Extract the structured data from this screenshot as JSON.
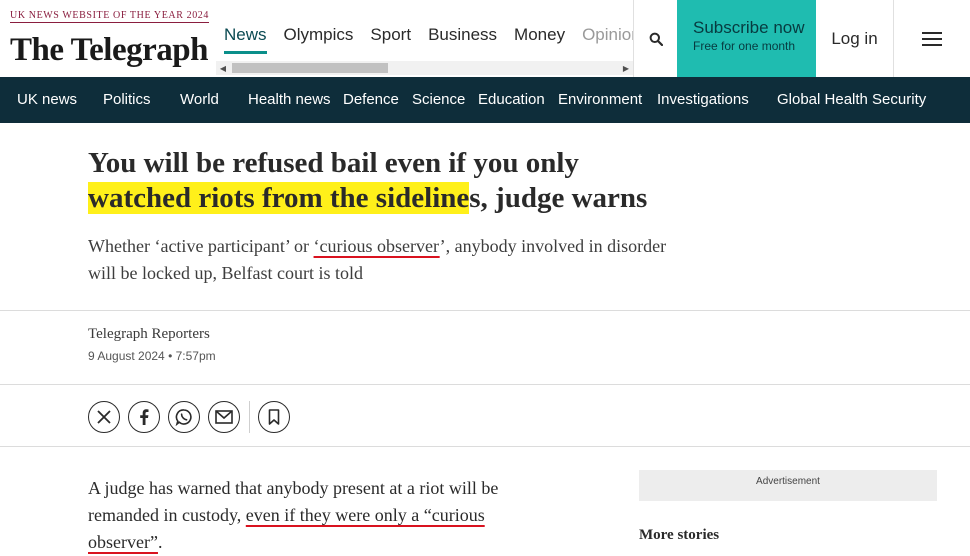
{
  "header": {
    "award": "UK NEWS WEBSITE OF THE YEAR 2024",
    "logo": "The Telegraph",
    "nav": [
      {
        "label": "News",
        "active": true
      },
      {
        "label": "Olympics"
      },
      {
        "label": "Sport"
      },
      {
        "label": "Business"
      },
      {
        "label": "Money"
      },
      {
        "label": "Opinion",
        "faded": true
      }
    ],
    "search_icon": "search-icon",
    "subscribe_title": "Subscribe now",
    "subscribe_sub": "Free for one month",
    "login": "Log in",
    "menu_icon": "hamburger-icon"
  },
  "sections": [
    "UK news",
    "Politics",
    "World",
    "Health news",
    "Defence",
    "Science",
    "Education",
    "Environment",
    "Investigations",
    "Global Health Security"
  ],
  "article": {
    "headline_part1": "You will be refused bail even if you only",
    "headline_highlight": "watched riots from the sideline",
    "headline_part2": "s, judge warns",
    "standfirst_pre": "Whether ‘active participant’ or ",
    "standfirst_underlined": "‘curious observer",
    "standfirst_post": "’, anybody involved in disorder will be locked up, Belfast court is told",
    "byline": "Telegraph Reporters",
    "date": "9 August 2024 • 7:57pm",
    "share_icons": [
      "x-icon",
      "facebook-icon",
      "whatsapp-icon",
      "email-icon",
      "bookmark-icon"
    ],
    "body_pre": "A judge has warned that anybody present at a riot will be remanded in custody, ",
    "body_underlined_1": "even if they were only a “curious",
    "body_space": " ",
    "body_underlined_2": "observer”",
    "body_post": "."
  },
  "sidebar": {
    "advert": "Advertisement",
    "more_stories": "More stories"
  },
  "colors": {
    "section_nav_bg": "#0e2d3a",
    "subscribe_bg": "#1fbcb0",
    "highlight": "#fff01a",
    "underline": "#d9121f"
  }
}
